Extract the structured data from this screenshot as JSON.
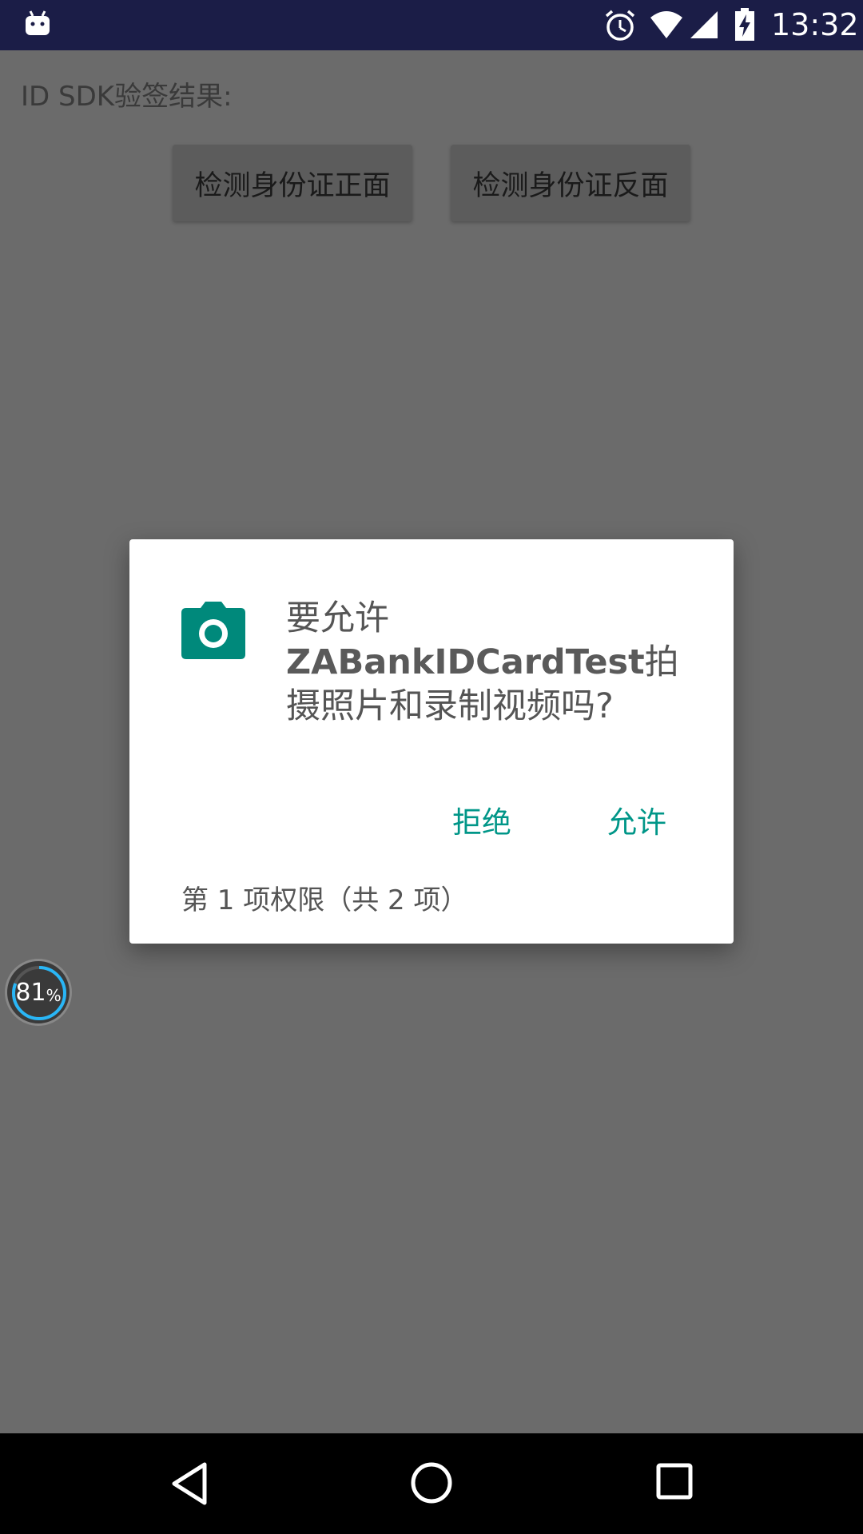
{
  "status_bar": {
    "time": "13:32",
    "icons": [
      "android-icon",
      "alarm-icon",
      "wifi-icon",
      "signal-icon",
      "battery-charging-icon"
    ]
  },
  "app": {
    "result_label": "ID SDK验签结果:",
    "btn_front": "检测身份证正面",
    "btn_back": "检测身份证反面"
  },
  "progress_widget": {
    "value": "81",
    "unit": "%",
    "fraction": 0.81
  },
  "dialog": {
    "icon": "camera-icon",
    "message_prefix": "要允许",
    "app_name": "ZABankIDCardTest",
    "message_suffix": "拍摄照片和录制视频吗?",
    "deny": "拒绝",
    "allow": "允许",
    "counter": "第 1 项权限（共 2 项）"
  },
  "colors": {
    "status_bar": "#1b1d47",
    "accent": "#009688",
    "scrim": "#6b6b6b"
  },
  "nav_bar": {
    "icons": [
      "back-icon",
      "home-icon",
      "recents-icon"
    ]
  }
}
